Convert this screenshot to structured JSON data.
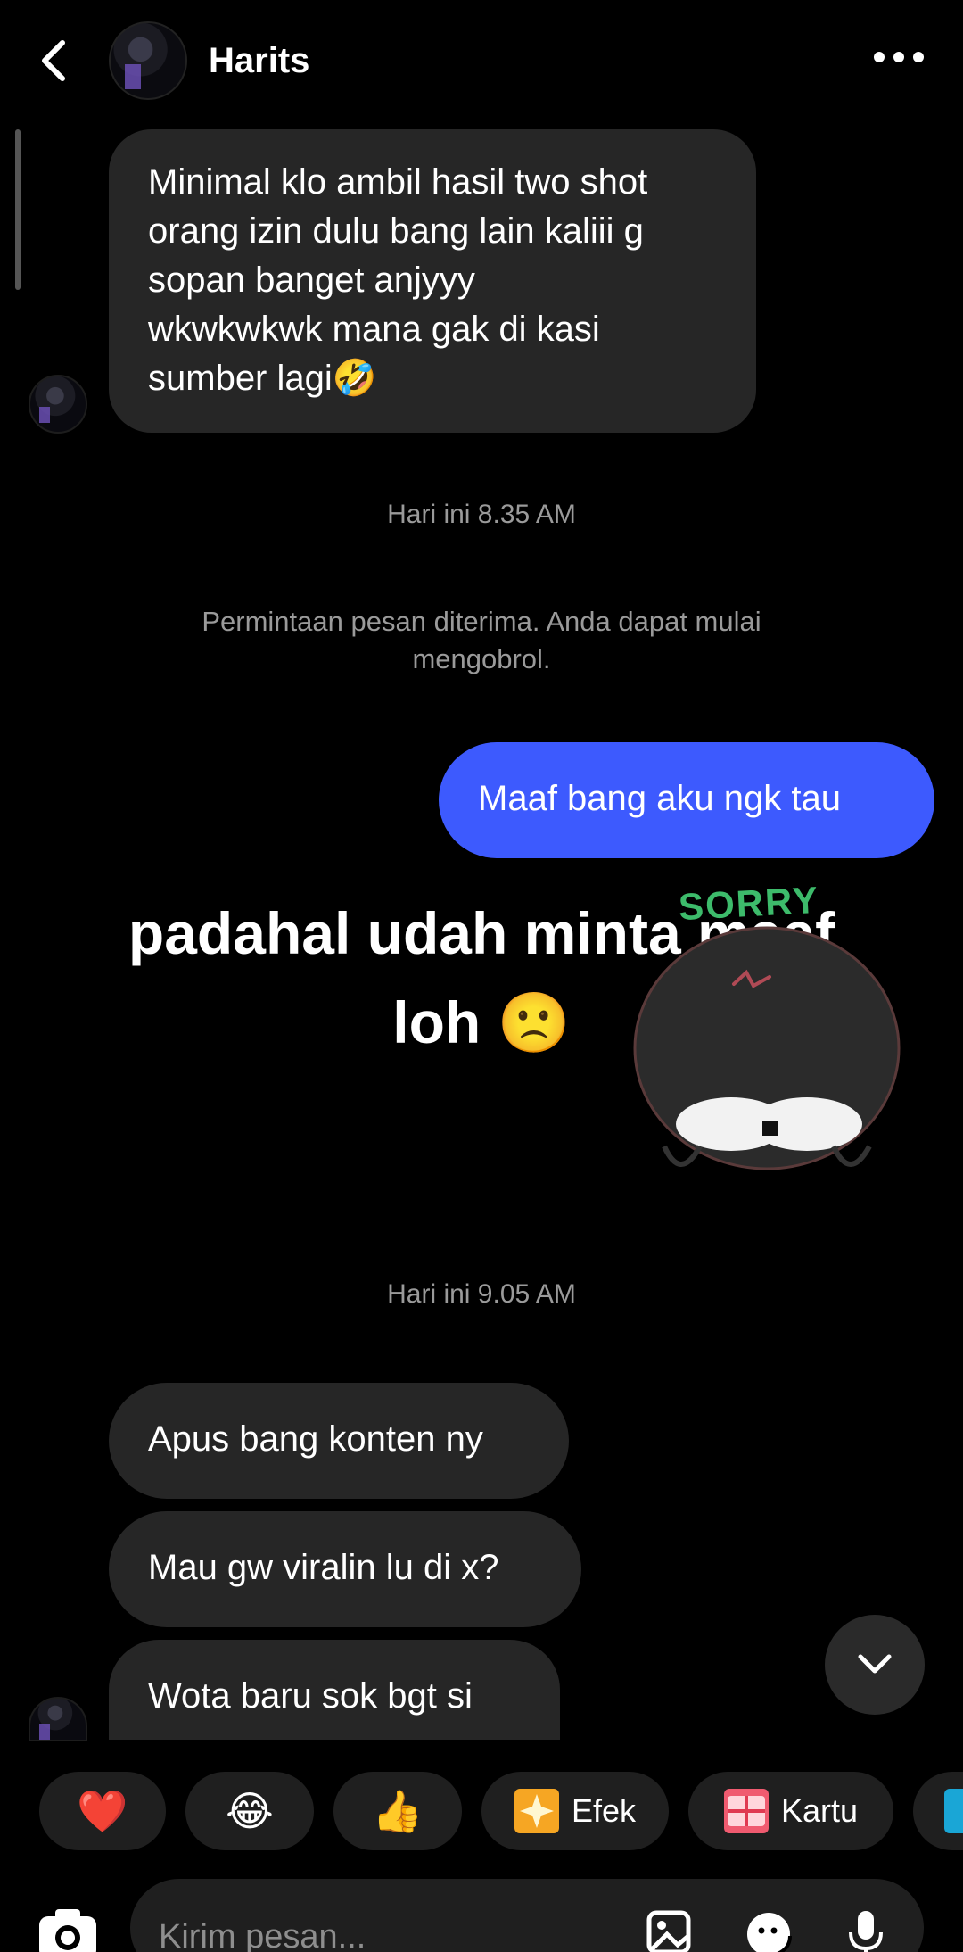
{
  "header": {
    "title": "Harits"
  },
  "messages": {
    "m1": [
      "Minimal klo ambil hasil two shot",
      "orang izin dulu bang lain kaliii g",
      "sopan banget anjyyy",
      "wkwkwkwk mana gak di kasi",
      "sumber lagi🤣"
    ],
    "time1": "Hari ini 8.35 AM",
    "system": "Permintaan pesan diterima. Anda dapat mulai mengobrol.",
    "sent1": "Maaf bang aku ngk tau",
    "time2": "Hari ini 9.05 AM",
    "m2": "Apus bang konten ny",
    "m3": "Mau gw viralin lu di x?",
    "m4": "Wota baru sok bgt si"
  },
  "overlay": {
    "line1": "padahal udah minta maaf",
    "line2": "loh 🙁"
  },
  "sticker": {
    "text": "SORRY"
  },
  "reactions": [
    {
      "emoji": "❤️",
      "label": ""
    },
    {
      "emoji": "😂",
      "label": ""
    },
    {
      "emoji": "👍",
      "label": ""
    },
    {
      "emoji": "",
      "label": "Efek"
    },
    {
      "emoji": "",
      "label": "Kartu"
    }
  ],
  "composer": {
    "placeholder": "Kirim pesan..."
  },
  "colors": {
    "accent": "#3d5afe",
    "bubble_in": "#262626",
    "background": "#000000"
  }
}
